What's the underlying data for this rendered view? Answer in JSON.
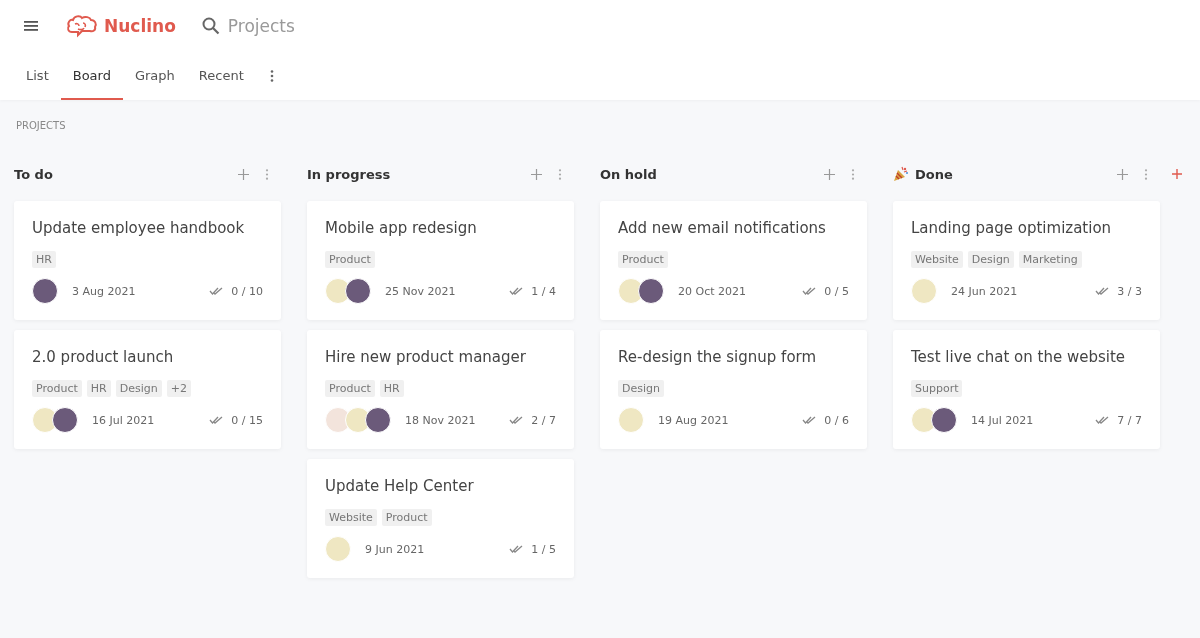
{
  "app": {
    "name": "Nuclino",
    "search": "Projects"
  },
  "tabs": [
    {
      "label": "List",
      "selected": false
    },
    {
      "label": "Board",
      "selected": true
    },
    {
      "label": "Graph",
      "selected": false
    },
    {
      "label": "Recent",
      "selected": false
    }
  ],
  "breadcrumb": "PROJECTS",
  "columns": [
    {
      "title": "To do",
      "emoji": false,
      "cards": [
        {
          "title": "Update employee handbook",
          "tags": [
            "HR"
          ],
          "avatars": [
            {
              "color": "#6b5a7a"
            }
          ],
          "date": "3 Aug 2021",
          "progress": "0 / 10"
        },
        {
          "title": "2.0 product launch",
          "tags": [
            "Product",
            "HR",
            "Design",
            "+2"
          ],
          "avatars": [
            {
              "color": "#efe7c2"
            },
            {
              "color": "#6b5a7a"
            }
          ],
          "date": "16 Jul 2021",
          "progress": "0 / 15"
        }
      ]
    },
    {
      "title": "In progress",
      "emoji": false,
      "cards": [
        {
          "title": "Mobile app redesign",
          "tags": [
            "Product"
          ],
          "avatars": [
            {
              "color": "#efe7c2"
            },
            {
              "color": "#6b5a7a"
            }
          ],
          "date": "25 Nov 2021",
          "progress": "1 / 4"
        },
        {
          "title": "Hire new product manager",
          "tags": [
            "Product",
            "HR"
          ],
          "avatars": [
            {
              "color": "#f3e4dc"
            },
            {
              "color": "#efe7c2"
            },
            {
              "color": "#6b5a7a"
            }
          ],
          "date": "18 Nov 2021",
          "progress": "2 / 7"
        },
        {
          "title": "Update Help Center",
          "tags": [
            "Website",
            "Product"
          ],
          "avatars": [
            {
              "color": "#efe7c2"
            }
          ],
          "date": "9 Jun 2021",
          "progress": "1 / 5"
        }
      ]
    },
    {
      "title": "On hold",
      "emoji": false,
      "cards": [
        {
          "title": "Add new email notifications",
          "tags": [
            "Product"
          ],
          "avatars": [
            {
              "color": "#efe7c2"
            },
            {
              "color": "#6b5a7a"
            }
          ],
          "date": "20 Oct 2021",
          "progress": "0 / 5"
        },
        {
          "title": "Re-design the signup form",
          "tags": [
            "Design"
          ],
          "avatars": [
            {
              "color": "#efe7c2"
            }
          ],
          "date": "19 Aug 2021",
          "progress": "0 / 6"
        }
      ]
    },
    {
      "title": "Done",
      "emoji": true,
      "cards": [
        {
          "title": "Landing page optimization",
          "tags": [
            "Website",
            "Design",
            "Marketing"
          ],
          "avatars": [
            {
              "color": "#efe7c2"
            }
          ],
          "date": "24 Jun 2021",
          "progress": "3 / 3"
        },
        {
          "title": "Test live chat on the website",
          "tags": [
            "Support"
          ],
          "avatars": [
            {
              "color": "#efe7c2"
            },
            {
              "color": "#6b5a7a"
            }
          ],
          "date": "14 Jul 2021",
          "progress": "7 / 7"
        }
      ]
    }
  ]
}
